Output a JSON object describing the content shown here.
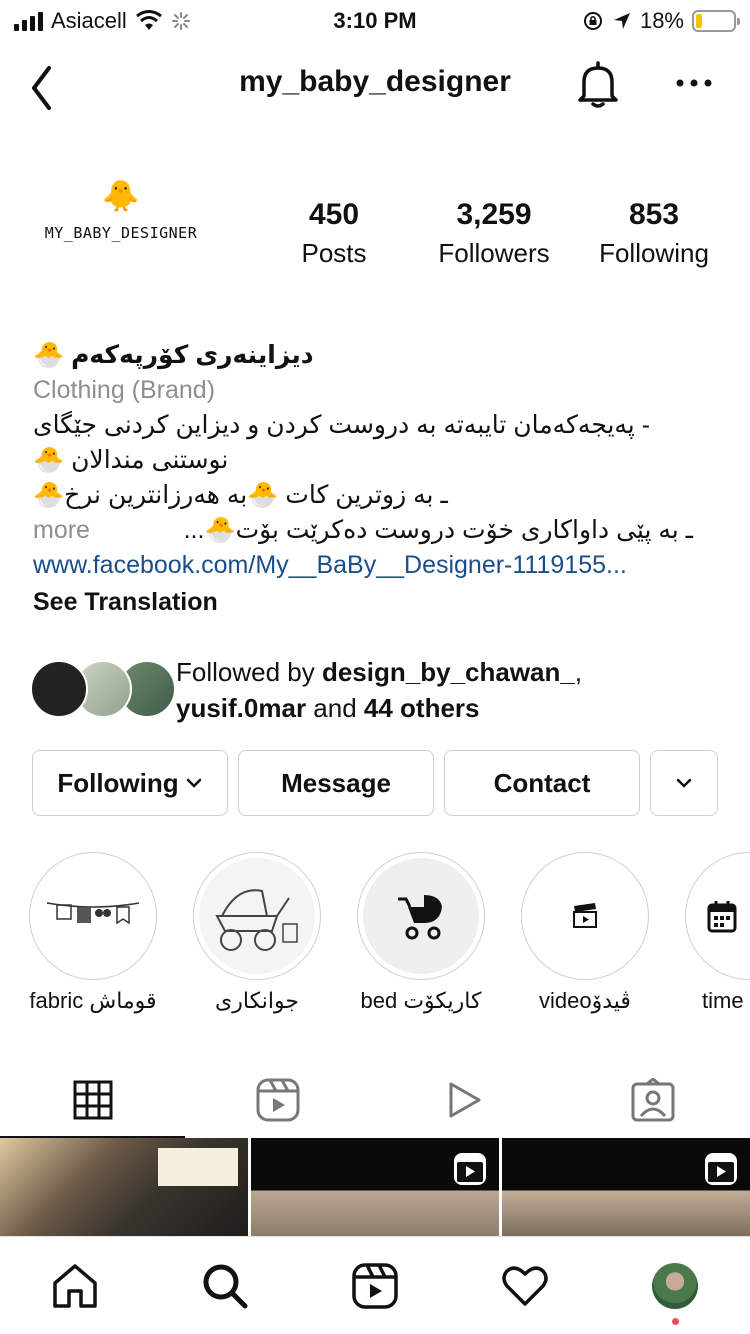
{
  "status_bar": {
    "carrier": "Asiacell",
    "time": "3:10 PM",
    "battery_percent": "18%",
    "battery_level": 0.18,
    "battery_color": "#f5c400",
    "icons": [
      "signal-icon",
      "wifi-icon",
      "loading-icon",
      "rotation-lock-icon",
      "location-arrow-icon",
      "battery-icon"
    ]
  },
  "header": {
    "username": "my_baby_designer",
    "icons": [
      "back-chevron-icon",
      "bell-icon",
      "more-dots-icon"
    ]
  },
  "profile": {
    "logo_text": "MY_BABY_DESIGNER",
    "logo_emoji": "🐥",
    "stats": [
      {
        "value": "450",
        "label": "Posts"
      },
      {
        "value": "3,259",
        "label": "Followers"
      },
      {
        "value": "853",
        "label": "Following"
      }
    ]
  },
  "bio": {
    "name": "دیزاینەری کۆرپەکەم 🐣",
    "category": "Clothing (Brand)",
    "lines": [
      "- پەیجەکەمان تایبەتە بە دروست کردن و دیزاین کردنی جێگای",
      "نوستنی مندالان 🐣",
      "ـ بە زوترین کات 🐣بە هەرزانترین نرخ🐣",
      "ـ بە پێی داواکاری خۆت دروست دەکرێت بۆت🐣..."
    ],
    "more": "more",
    "link": "www.facebook.com/My__BaBy__Designer-1119155...",
    "see_translation": "See Translation"
  },
  "followed_by": {
    "prefix": "Followed by ",
    "user1": "design_by_chawan_",
    "sep": ",",
    "user2": "yusif.0mar",
    "and": " and ",
    "others": "44 others"
  },
  "buttons": {
    "following": "Following",
    "message": "Message",
    "contact": "Contact"
  },
  "highlights": [
    {
      "label": "fabric قوماش",
      "icon": "clothesline-icon"
    },
    {
      "label": "جوانکاری",
      "icon": "stroller-sketch-icon"
    },
    {
      "label": "bed کاریکۆت",
      "icon": "stroller-icon"
    },
    {
      "label": "videoڤیدۆ",
      "icon": "clapperboard-icon"
    },
    {
      "label": "time",
      "icon": "calendar-icon"
    }
  ],
  "tabs": {
    "active": "grid",
    "items": [
      "grid-icon",
      "reels-icon",
      "play-icon",
      "tagged-icon"
    ]
  },
  "bottom_nav": {
    "items": [
      "home-icon",
      "search-icon",
      "reels-icon",
      "heart-icon",
      "profile-avatar"
    ],
    "notification_color": "#ed4956"
  }
}
